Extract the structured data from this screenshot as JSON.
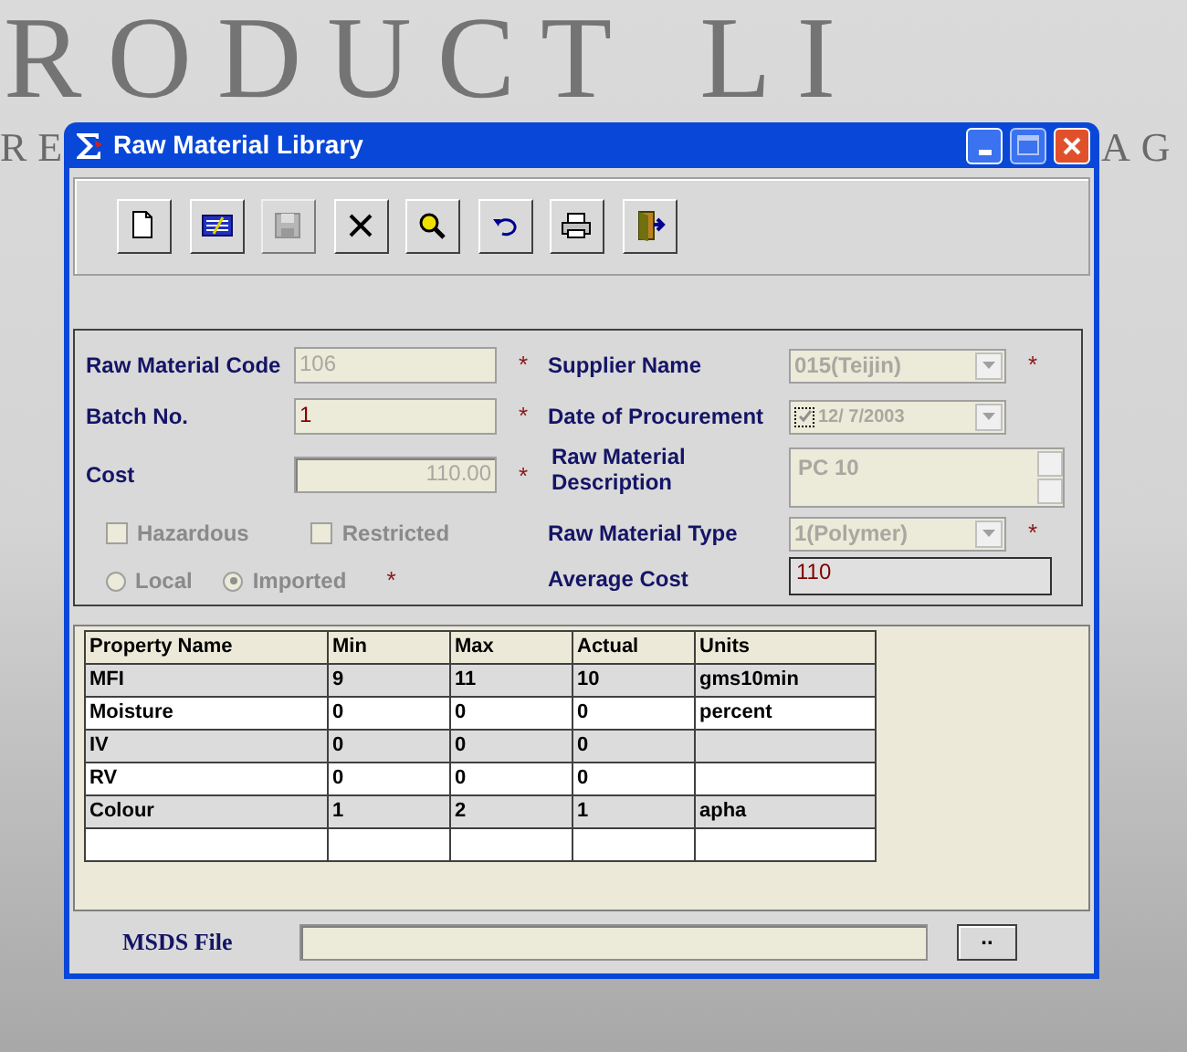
{
  "background": {
    "title_words": [
      "RODUCT",
      "LI"
    ],
    "subtitle_left": "RE",
    "subtitle_right": "AG"
  },
  "window": {
    "title": "Raw Material Library"
  },
  "toolbar": [
    {
      "kind": "new",
      "disabled": false
    },
    {
      "kind": "list",
      "disabled": false
    },
    {
      "kind": "save",
      "disabled": true
    },
    {
      "kind": "delete",
      "disabled": false
    },
    {
      "kind": "find",
      "disabled": false
    },
    {
      "kind": "undo",
      "disabled": false
    },
    {
      "kind": "print",
      "disabled": false
    },
    {
      "kind": "exit",
      "disabled": false
    }
  ],
  "left_fields": [
    {
      "label": "Raw Material Code",
      "kind": "text",
      "value": "106",
      "disabled": true,
      "required_mark": "*"
    },
    {
      "label": "Batch No.",
      "kind": "text",
      "value": "1",
      "disabled": false,
      "required_mark": "*"
    },
    {
      "label": "Cost",
      "kind": "number",
      "value": "110.00",
      "disabled": true,
      "required_mark": "*"
    }
  ],
  "checkboxes": [
    {
      "label": "Hazardous",
      "checked": false
    },
    {
      "label": "Restricted",
      "checked": false
    }
  ],
  "origin": {
    "options": [
      {
        "label": "Local",
        "selected": false
      },
      {
        "label": "Imported",
        "selected": true
      }
    ],
    "required_mark": "*"
  },
  "right_fields": [
    {
      "label": "Supplier Name",
      "kind": "combo",
      "value": "015(Teijin)",
      "required_mark": "*"
    },
    {
      "label": "Date of Procurement",
      "kind": "date",
      "value": "12/ 7/2003",
      "checked": true
    },
    {
      "label": "Raw Material Description",
      "kind": "memo",
      "value": "PC 10"
    },
    {
      "label": "Raw Material Type",
      "kind": "combo",
      "value": "1(Polymer)",
      "required_mark": "*"
    },
    {
      "label": "Average Cost",
      "kind": "display",
      "value": "110"
    }
  ],
  "table": {
    "columns": [
      "Property Name",
      "Min",
      "Max",
      "Actual",
      "Units"
    ],
    "rows": [
      [
        "MFI",
        "9",
        "11",
        "10",
        "gms10min"
      ],
      [
        "Moisture",
        "0",
        "0",
        "0",
        "percent"
      ],
      [
        "IV",
        "0",
        "0",
        "0"
      ],
      [
        "RV",
        "0",
        "0",
        "0"
      ],
      [
        "Colour",
        "1",
        "2",
        "1",
        "apha"
      ]
    ]
  },
  "msds": {
    "label": "MSDS File",
    "button": ".."
  }
}
